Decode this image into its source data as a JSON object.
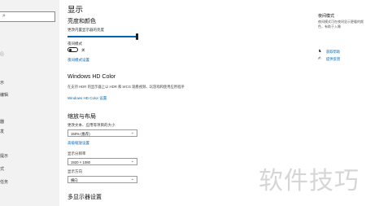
{
  "sidebar": {
    "search_icon": "search-icon",
    "items": [
      {
        "label": "ⓘ"
      },
      {
        "label": "示"
      },
      {
        "label": "编辑"
      },
      {
        "label": "器"
      },
      {
        "label": "发"
      },
      {
        "label": "提示"
      },
      {
        "label": "式"
      },
      {
        "label": "任务"
      }
    ]
  },
  "main": {
    "title": "显示",
    "brightness": {
      "section_title": "亮度和颜色",
      "slider_label": "更改内置显示器的亮度",
      "night_light_label": "夜间模式",
      "toggle_state": "关",
      "settings_link": "夜间模式设置"
    },
    "hdr": {
      "section_title": "Windows HD Color",
      "description": "在支持 HDR 的显示器上以 HDR 和 WCG 观看视频、玩游戏和使用应用程序",
      "link": "Windows HD Color 设置"
    },
    "layout": {
      "section_title": "缩放与布局",
      "scale_label": "更改文本、应用等项目的大小",
      "scale_value": "150% (推荐)",
      "advanced_link": "高级缩放设置",
      "resolution_label": "显示分辨率",
      "resolution_value": "1920 × 1080",
      "orientation_label": "显示方向",
      "orientation_value": "横向"
    },
    "multi_display": {
      "section_title": "多显示器设置"
    }
  },
  "right_pane": {
    "title": "夜间模式",
    "description": "夜间模式可在夜间显示更暖的颜色，有助于入睡",
    "links": [
      {
        "label": "获取帮助",
        "icon": "help-icon"
      },
      {
        "label": "提供反馈",
        "icon": "feedback-icon"
      }
    ]
  },
  "watermark": "软件技巧",
  "colors": {
    "accent": "#0066b4",
    "sidebar_bg": "#f2f2f2"
  }
}
